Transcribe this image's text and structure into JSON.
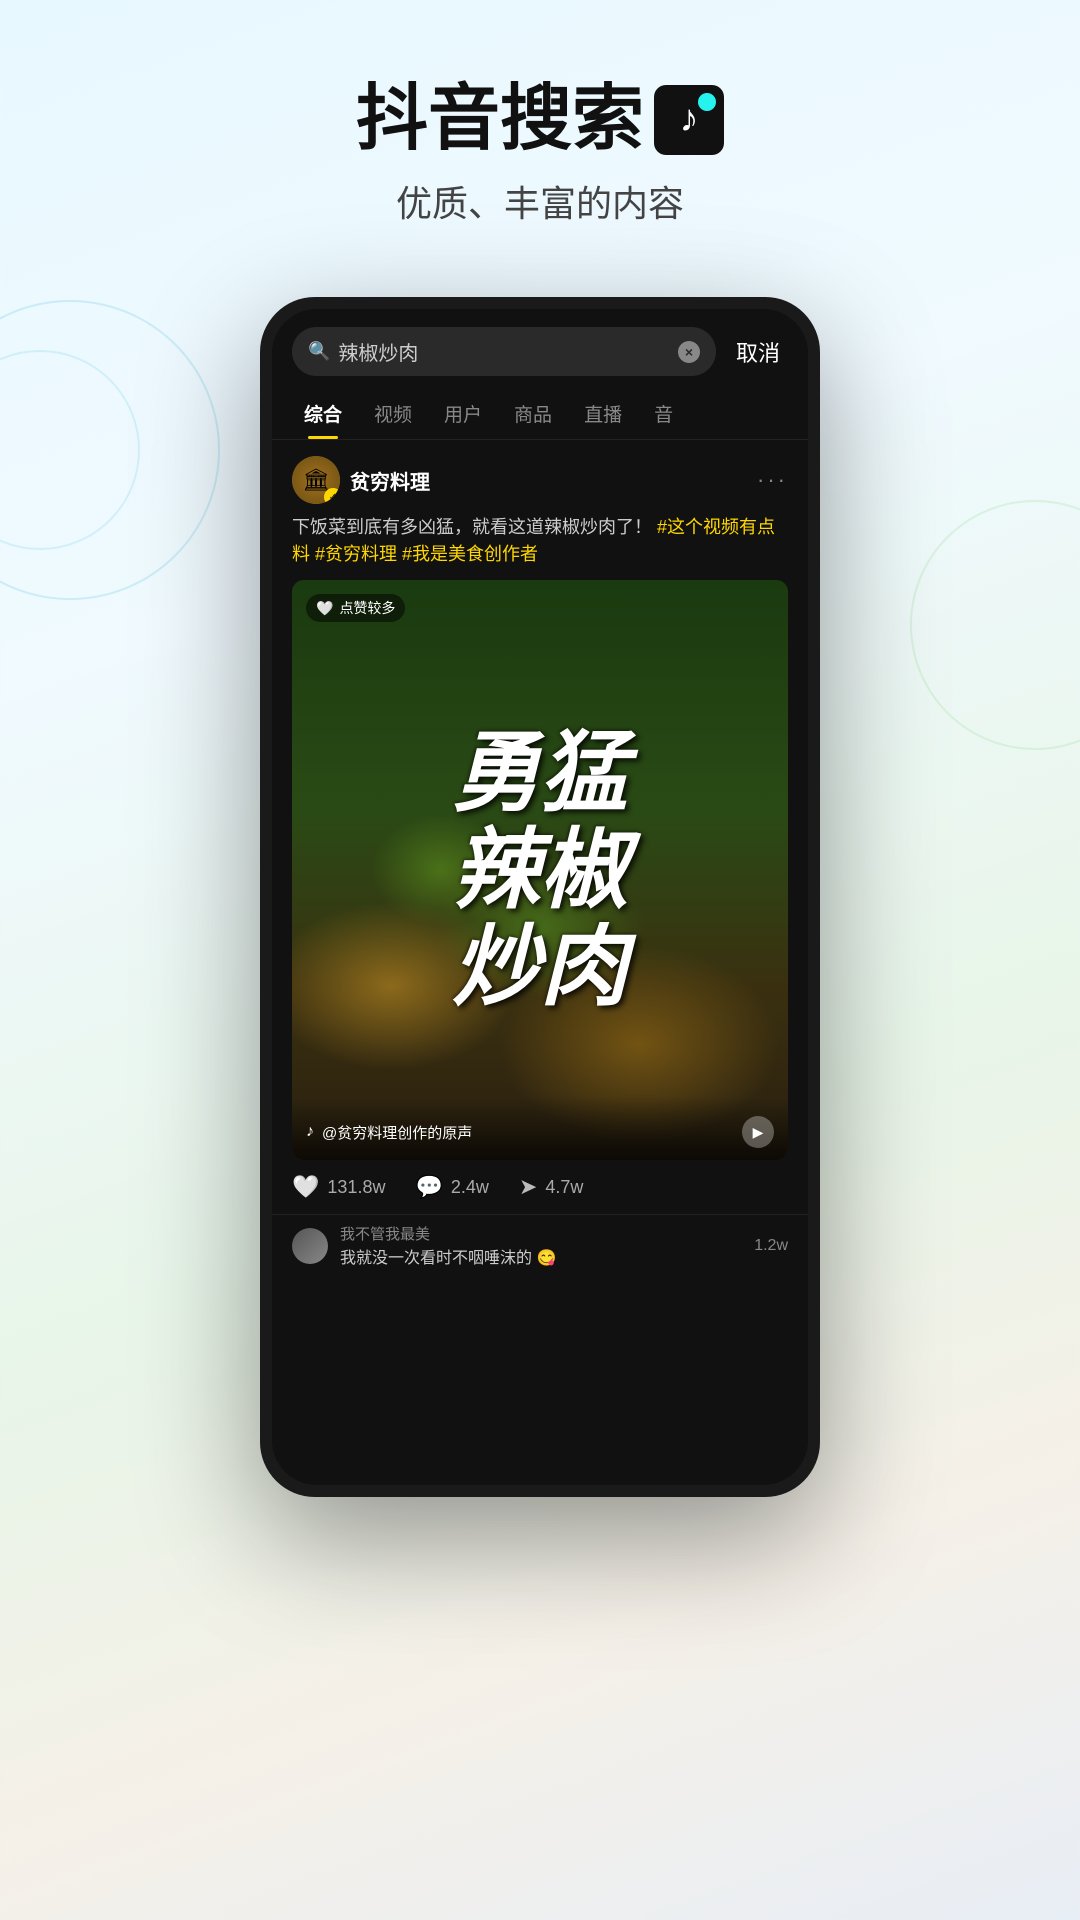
{
  "header": {
    "title": "抖音搜索",
    "logo_symbol": "♪",
    "subtitle": "优质、丰富的内容"
  },
  "phone": {
    "search_bar": {
      "query": "辣椒炒肉",
      "placeholder": "辣椒炒肉",
      "cancel_label": "取消",
      "clear_icon": "×"
    },
    "tabs": [
      {
        "label": "综合",
        "active": true
      },
      {
        "label": "视频",
        "active": false
      },
      {
        "label": "用户",
        "active": false
      },
      {
        "label": "商品",
        "active": false
      },
      {
        "label": "直播",
        "active": false
      },
      {
        "label": "音",
        "active": false
      }
    ],
    "post": {
      "username": "贫穷料理",
      "avatar_emoji": "🏛",
      "more_icon": "···",
      "description": "下饭菜到底有多凶猛，就看这道辣椒炒肉了！",
      "tags": "#这个视频有点料 #贫穷料理 #我是美食创作者",
      "video": {
        "badge_text": "点赞较多",
        "overlay_text": "勇猛的辣椒炒肉",
        "overlay_lines": [
          "勇",
          "猛",
          "辣",
          "椒炒",
          "肉"
        ],
        "audio_text": "@贫穷料理创作的原声",
        "play_icon": "▶"
      },
      "stats": {
        "likes": "131.8w",
        "comments": "2.4w",
        "shares": "4.7w"
      },
      "comment_preview": {
        "commenter": "我不管我最美",
        "comment_text": "我就没一次看时不咽唾沫的 😋",
        "count": "1.2w"
      }
    }
  }
}
